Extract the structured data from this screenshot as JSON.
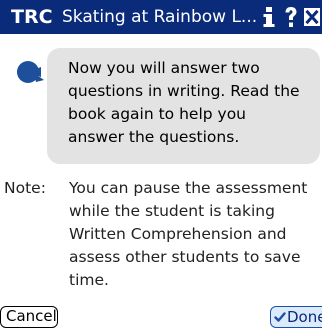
{
  "window": {
    "app_badge": "TRC",
    "title": "Skating at Rainbow L..."
  },
  "titlebar_icons": [
    "info-icon",
    "help-icon",
    "close-icon"
  ],
  "dialog": {
    "speaker_icon": "speaker-avatar-icon",
    "bubble_lines": [
      "Now you will answer two",
      "questions in writing. Read the",
      "book again to help you",
      "answer the questions."
    ],
    "note_label": "Note:",
    "note_lines": [
      "You can pause the assessment",
      "while the student is taking",
      "Written Comprehension and",
      "assess other students to save",
      "time."
    ]
  },
  "buttons": {
    "cancel_label": "Cancel",
    "done_label": "Done"
  },
  "colors": {
    "titlebar_bg": "#0a2a7a",
    "bubble_bg": "#e3e3e3",
    "speaker_icon": "#1e4f9a",
    "done_button_bg": "#dcebfb",
    "done_button_border": "#1d4fa8"
  }
}
